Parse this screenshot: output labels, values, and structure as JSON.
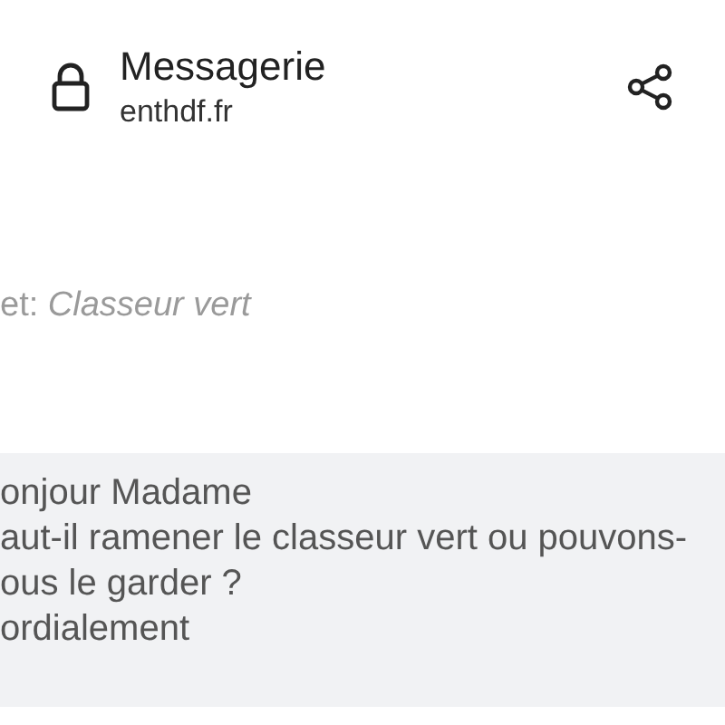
{
  "header": {
    "title": "Messagerie",
    "url": "enthdf.fr"
  },
  "subject": "et: *Classeur vert*",
  "message": {
    "lines": [
      "onjour Madame",
      "aut-il ramener le classeur vert ou pouvons-",
      "ous le garder ?",
      "ordialement"
    ]
  }
}
